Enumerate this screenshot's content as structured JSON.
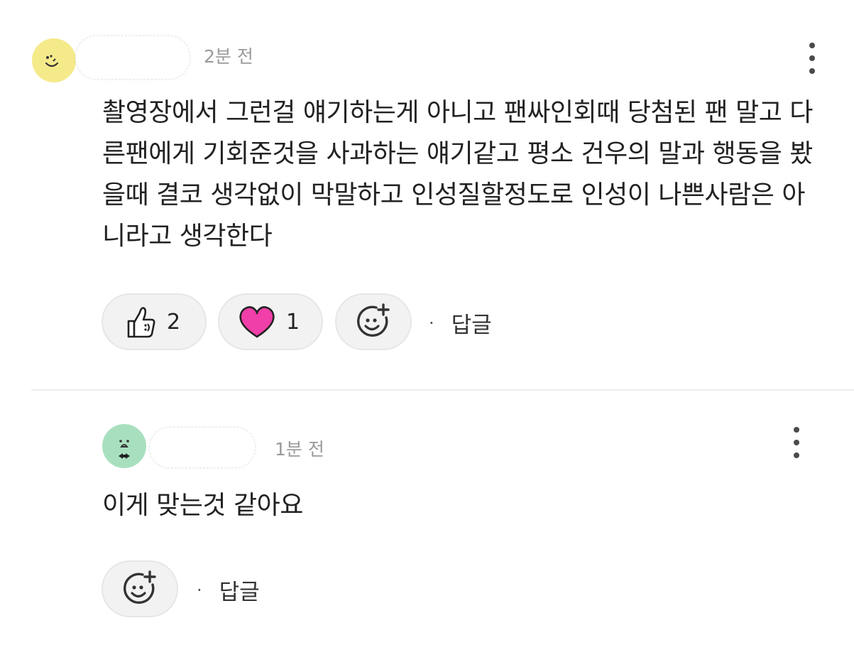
{
  "comments": [
    {
      "time": "2분 전",
      "text": "촬영장에서 그런걸 얘기하는게 아니고 팬싸인회때 당첨된 팬 말고 다른팬에게 기회준것을 사과하는 얘기같고 평소 건우의 말과 행동을 봤을때 결코 생각없이 막말하고 인성질할정도로 인성이 나쁜사람은 아니라고 생각한다",
      "reactions": {
        "like_count": "2",
        "heart_count": "1"
      },
      "reply_label": "답글",
      "separator": "·"
    },
    {
      "time": "1분 전",
      "text": "이게 맞는것 같아요",
      "reply_label": "답글",
      "separator": "·"
    }
  ],
  "colors": {
    "avatar_yellow": "#f5ea8a",
    "avatar_green": "#a8e0bf",
    "heart_pink": "#f03fa8",
    "muted_text": "#9a9a9a"
  },
  "icons": [
    "smile-avatar-icon",
    "kebab-menu-icon",
    "thumbs-up-icon",
    "heart-icon",
    "add-reaction-icon"
  ]
}
